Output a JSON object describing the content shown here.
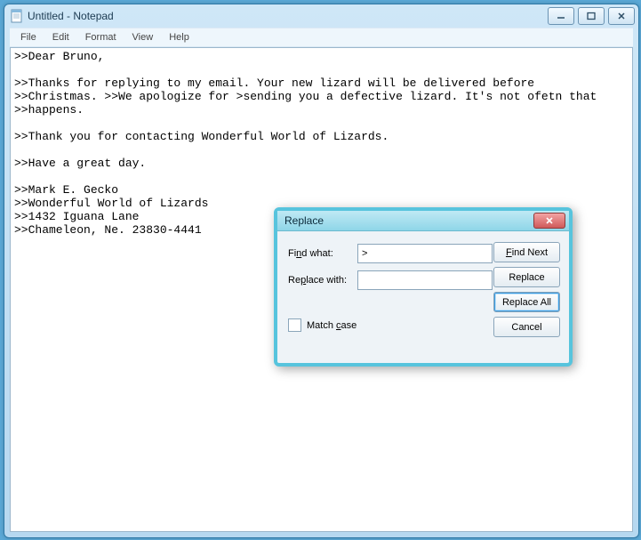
{
  "window": {
    "title": "Untitled - Notepad",
    "menus": {
      "file": "File",
      "edit": "Edit",
      "format": "Format",
      "view": "View",
      "help": "Help"
    }
  },
  "editor": {
    "text": ">>Dear Bruno,\n\n>>Thanks for replying to my email. Your new lizard will be delivered before\n>>Christmas. >>We apologize for >sending you a defective lizard. It's not ofetn that\n>>happens.\n\n>>Thank you for contacting Wonderful World of Lizards.\n\n>>Have a great day.\n\n>>Mark E. Gecko\n>>Wonderful World of Lizards\n>>1432 Iguana Lane\n>>Chameleon, Ne. 23830-4441"
  },
  "dialog": {
    "title": "Replace",
    "find_label_pre": "Fi",
    "find_label_u": "n",
    "find_label_post": "d what:",
    "find_value": ">",
    "replace_label_pre": "Re",
    "replace_label_u": "p",
    "replace_label_post": "lace with:",
    "replace_value": "",
    "match_case_pre": "Match ",
    "match_case_u": "c",
    "match_case_post": "ase",
    "buttons": {
      "find_next": "Find Next",
      "replace": "Replace",
      "replace_all": "Replace All",
      "cancel": "Cancel"
    }
  }
}
